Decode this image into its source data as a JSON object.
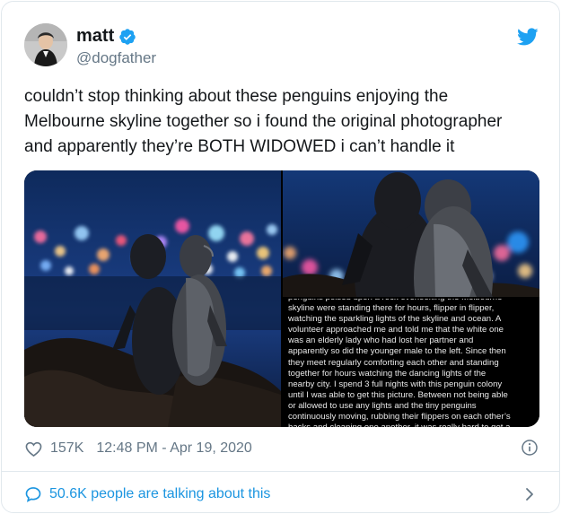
{
  "author": {
    "display_name": "matt",
    "handle": "@dogfather",
    "verified": true,
    "verified_color": "#1da1f2"
  },
  "brand": {
    "icon": "twitter-bird-icon",
    "color": "#1da1f2"
  },
  "tweet": {
    "text": "couldn’t stop thinking about these penguins enjoying the\nMelbourne skyline together so i found the original photographer\nand apparently they’re BOTH WIDOWED i can’t handle it"
  },
  "media": {
    "caption": "penguins poised upon a rock overlooking the Melbourne\nskyline were standing there for hours, flipper in flipper,\nwatching the sparkling lights of the skyline and ocean. A\nvolunteer approached me and told me that the white one\nwas an elderly lady who had lost her partner and\napparently so did the younger male to the left. Since then\nthey meet regularly comforting each other and standing\ntogether for hours watching the dancing lights of the\nnearby city. I spend 3 full nights with this penguin colony\nuntil I was able to get this picture. Between not being able\nor allowed to use any lights and the tiny penguins\ncontinuously moving, rubbing their flippers on each other’s\nbacks and cleaning one another, it was really hard to get a"
  },
  "meta": {
    "likes": "157K",
    "timestamp": "12:48 PM - Apr 19, 2020",
    "like_icon": "heart-icon",
    "info_icon": "info-icon"
  },
  "footer": {
    "talking": "50.6K people are talking about this",
    "link_color": "#1b95e0",
    "icon": "speech-bubble-icon"
  }
}
